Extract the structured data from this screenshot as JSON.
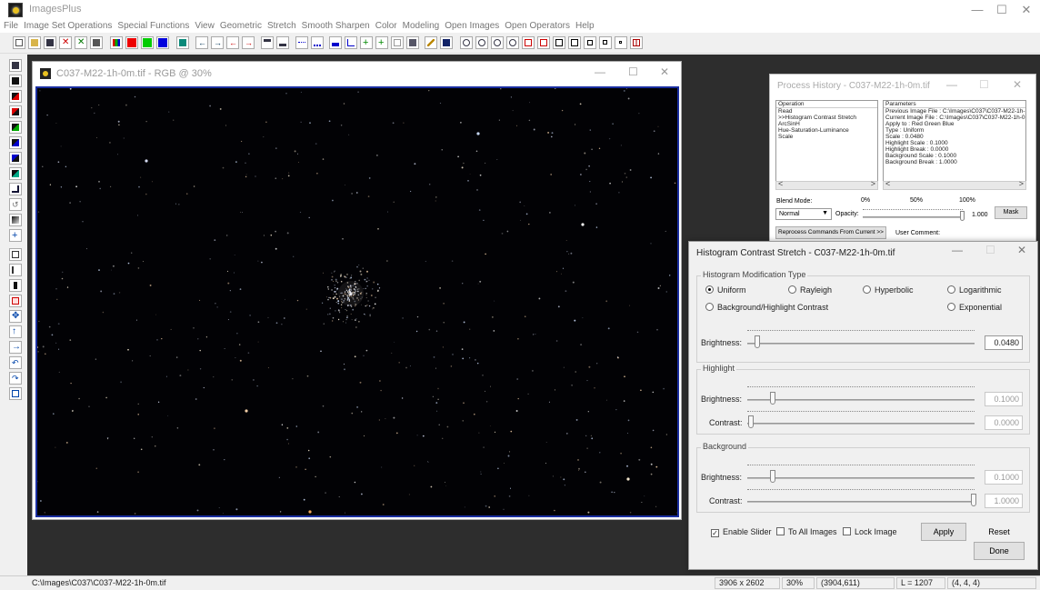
{
  "app": {
    "title": "ImagesPlus",
    "minimize": "—",
    "maximize": "☐",
    "close": "✕"
  },
  "menu": [
    "File",
    "Image Set Operations",
    "Special Functions",
    "View",
    "Geometric",
    "Stretch",
    "Smooth Sharpen",
    "Color",
    "Modeling",
    "Open Images",
    "Open Operators",
    "Help"
  ],
  "image_window": {
    "title": "C037-M22-1h-0m.tif - RGB @ 30%"
  },
  "process_history": {
    "title": "Process History - C037-M22-1h-0m.tif",
    "operation_header": "Operation",
    "operations": [
      "Read",
      ">>Histogram Contrast Stretch",
      "ArcSinH",
      "Hue-Saturation-Luminance",
      "Scale"
    ],
    "parameters_header": "Parameters",
    "parameters": [
      "Previous Image File : C:\\Images\\C037\\C037-M22-1h-...",
      "Current Image File : C:\\Images\\C037\\C037-M22-1h-0...",
      "Apply to : Red Green Blue",
      "Type : Uniform",
      "Scale : 0.0480",
      "Highlight Scale : 0.1000",
      "Highlight Break : 0.0000",
      "Background Scale : 0.1000",
      "Background Break : 1.0000"
    ],
    "blend_mode_label": "Blend Mode:",
    "blend_mode_value": "Normal",
    "pct0": "0%",
    "pct50": "50%",
    "pct100": "100%",
    "opacity_label": "Opacity:",
    "opacity_value": "1.000",
    "mask_button": "Mask",
    "reprocess_button": "Reprocess Commands From Current >>",
    "user_comment_label": "User Comment:"
  },
  "hcs": {
    "title": "Histogram Contrast Stretch - C037-M22-1h-0m.tif",
    "type_group": "Histogram Modification Type",
    "types": {
      "uniform": "Uniform",
      "rayleigh": "Rayleigh",
      "hyperbolic": "Hyperbolic",
      "logarithmic": "Logarithmic",
      "bg_hl": "Background/Highlight Contrast",
      "exponential": "Exponential"
    },
    "selected_type": "Uniform",
    "brightness_label": "Brightness:",
    "brightness_value": "0.0480",
    "highlight_group": "Highlight",
    "hl_brightness_label": "Brightness:",
    "hl_brightness_value": "0.1000",
    "hl_contrast_label": "Contrast:",
    "hl_contrast_value": "0.0000",
    "background_group": "Background",
    "bg_brightness_label": "Brightness:",
    "bg_brightness_value": "0.1000",
    "bg_contrast_label": "Contrast:",
    "bg_contrast_value": "1.0000",
    "enable_slider": "Enable Slider",
    "to_all_images": "To All Images",
    "lock_image": "Lock Image",
    "apply": "Apply",
    "reset": "Reset",
    "done": "Done"
  },
  "status": {
    "path": "C:\\Images\\C037\\C037-M22-1h-0m.tif",
    "dimensions": "3906 x 2602",
    "zoom": "30%",
    "coords": "(3904,611)",
    "luminance": "L = 1207",
    "rgb": "(4, 4, 4)"
  },
  "colors": {
    "image_border": "#1a2ea0",
    "workspace": "#2d2d2d"
  }
}
